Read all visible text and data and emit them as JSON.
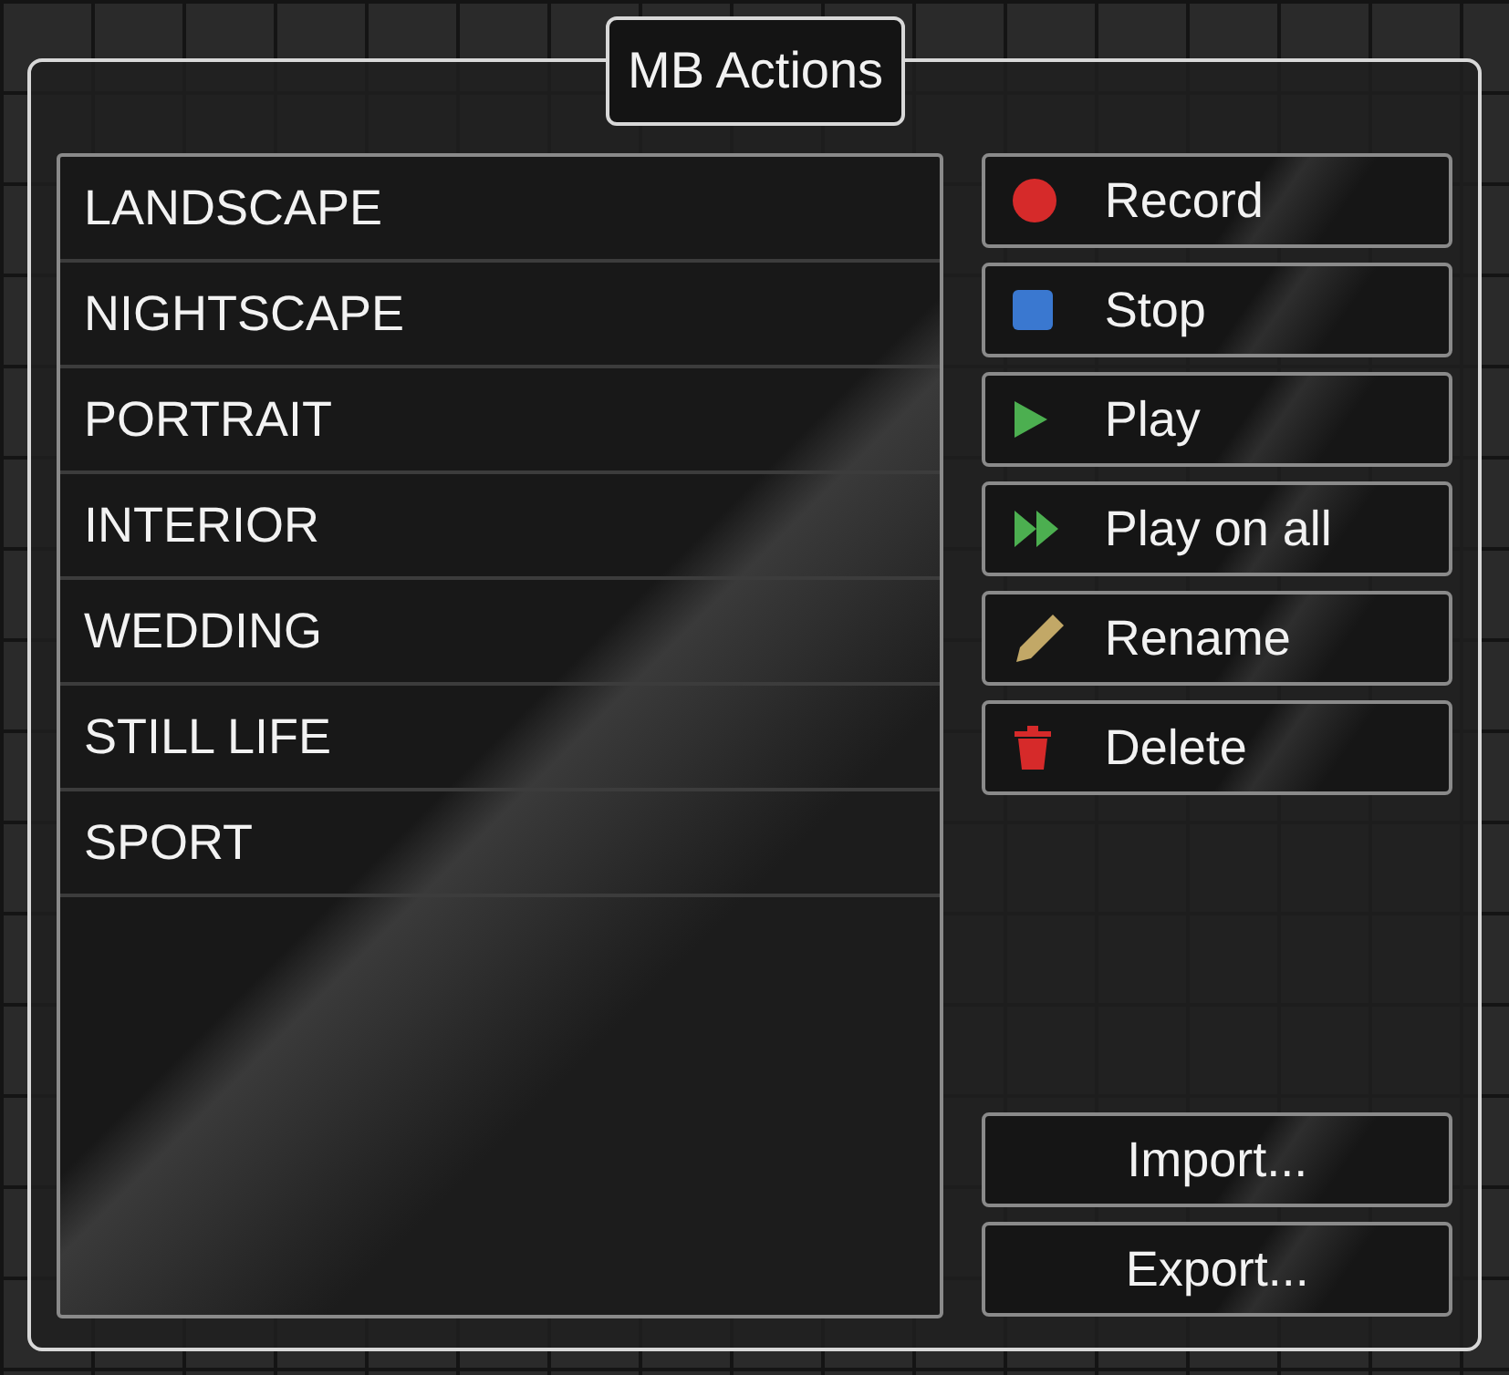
{
  "panel": {
    "title": "MB Actions"
  },
  "actions_list": [
    "LANDSCAPE",
    "NIGHTSCAPE",
    "PORTRAIT",
    "INTERIOR",
    "WEDDING",
    "STILL LIFE",
    "SPORT"
  ],
  "action_buttons": [
    {
      "kind": "record",
      "label": "Record"
    },
    {
      "kind": "stop",
      "label": "Stop"
    },
    {
      "kind": "play",
      "label": "Play"
    },
    {
      "kind": "play_all",
      "label": "Play on all"
    },
    {
      "kind": "rename",
      "label": "Rename"
    },
    {
      "kind": "delete",
      "label": "Delete"
    }
  ],
  "file_buttons": [
    "Import...",
    "Export..."
  ]
}
